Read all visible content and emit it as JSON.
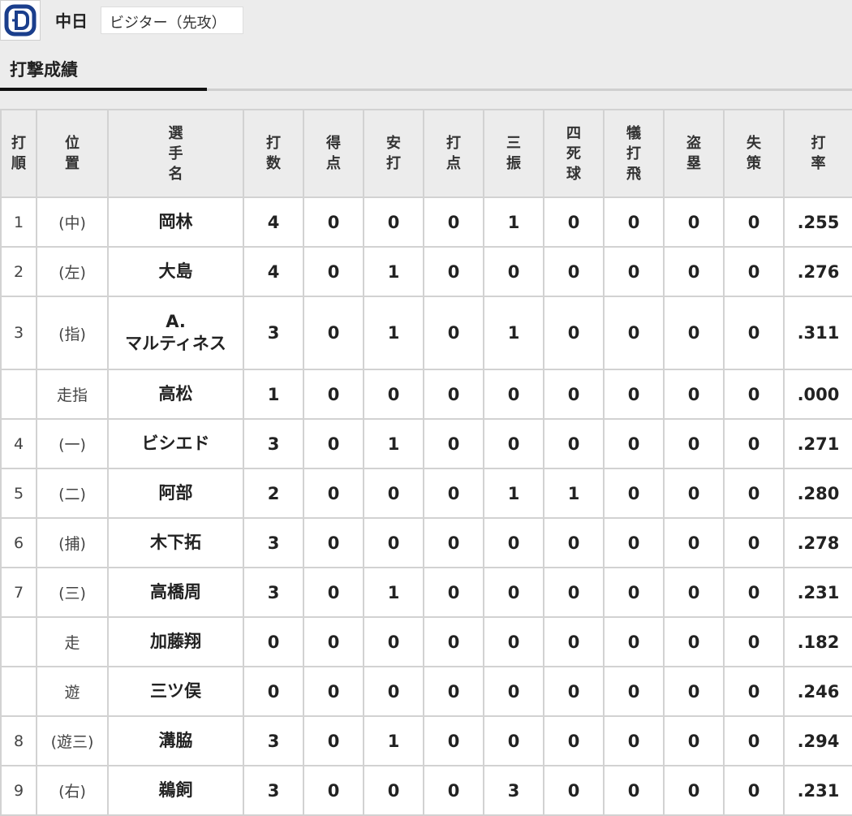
{
  "team": {
    "name": "中日",
    "side_label": "ビジター（先攻）",
    "logo_icon": "dragons-logo-icon",
    "logo_color": "#1a3e8c"
  },
  "tabs": {
    "active_label": "打撃成績"
  },
  "table": {
    "headers": [
      "打\n順",
      "位\n置",
      "選\n手\n名",
      "打\n数",
      "得\n点",
      "安\n打",
      "打\n点",
      "三\n振",
      "四\n死\n球",
      "犠\n打\n飛",
      "盗\n塁",
      "失\n策",
      "打\n率"
    ],
    "rows": [
      {
        "order": "1",
        "pos": "(中)",
        "player": "岡林",
        "ab": "4",
        "r": "0",
        "h": "0",
        "rbi": "0",
        "so": "1",
        "bb": "0",
        "sac": "0",
        "sb": "0",
        "e": "0",
        "avg": ".255"
      },
      {
        "order": "2",
        "pos": "(左)",
        "player": "大島",
        "ab": "4",
        "r": "0",
        "h": "1",
        "rbi": "0",
        "so": "0",
        "bb": "0",
        "sac": "0",
        "sb": "0",
        "e": "0",
        "avg": ".276"
      },
      {
        "order": "3",
        "pos": "(指)",
        "player": "A.\nマルティネス",
        "ab": "3",
        "r": "0",
        "h": "1",
        "rbi": "0",
        "so": "1",
        "bb": "0",
        "sac": "0",
        "sb": "0",
        "e": "0",
        "avg": ".311"
      },
      {
        "order": "",
        "pos": "走指",
        "player": "高松",
        "ab": "1",
        "r": "0",
        "h": "0",
        "rbi": "0",
        "so": "0",
        "bb": "0",
        "sac": "0",
        "sb": "0",
        "e": "0",
        "avg": ".000"
      },
      {
        "order": "4",
        "pos": "(一)",
        "player": "ビシエド",
        "ab": "3",
        "r": "0",
        "h": "1",
        "rbi": "0",
        "so": "0",
        "bb": "0",
        "sac": "0",
        "sb": "0",
        "e": "0",
        "avg": ".271"
      },
      {
        "order": "5",
        "pos": "(二)",
        "player": "阿部",
        "ab": "2",
        "r": "0",
        "h": "0",
        "rbi": "0",
        "so": "1",
        "bb": "1",
        "sac": "0",
        "sb": "0",
        "e": "0",
        "avg": ".280"
      },
      {
        "order": "6",
        "pos": "(捕)",
        "player": "木下拓",
        "ab": "3",
        "r": "0",
        "h": "0",
        "rbi": "0",
        "so": "0",
        "bb": "0",
        "sac": "0",
        "sb": "0",
        "e": "0",
        "avg": ".278"
      },
      {
        "order": "7",
        "pos": "(三)",
        "player": "高橋周",
        "ab": "3",
        "r": "0",
        "h": "1",
        "rbi": "0",
        "so": "0",
        "bb": "0",
        "sac": "0",
        "sb": "0",
        "e": "0",
        "avg": ".231"
      },
      {
        "order": "",
        "pos": "走",
        "player": "加藤翔",
        "ab": "0",
        "r": "0",
        "h": "0",
        "rbi": "0",
        "so": "0",
        "bb": "0",
        "sac": "0",
        "sb": "0",
        "e": "0",
        "avg": ".182"
      },
      {
        "order": "",
        "pos": "遊",
        "player": "三ツ俣",
        "ab": "0",
        "r": "0",
        "h": "0",
        "rbi": "0",
        "so": "0",
        "bb": "0",
        "sac": "0",
        "sb": "0",
        "e": "0",
        "avg": ".246"
      },
      {
        "order": "8",
        "pos": "(遊三)",
        "player": "溝脇",
        "ab": "3",
        "r": "0",
        "h": "1",
        "rbi": "0",
        "so": "0",
        "bb": "0",
        "sac": "0",
        "sb": "0",
        "e": "0",
        "avg": ".294"
      },
      {
        "order": "9",
        "pos": "(右)",
        "player": "鵜飼",
        "ab": "3",
        "r": "0",
        "h": "0",
        "rbi": "0",
        "so": "3",
        "bb": "0",
        "sac": "0",
        "sb": "0",
        "e": "0",
        "avg": ".231"
      }
    ]
  }
}
